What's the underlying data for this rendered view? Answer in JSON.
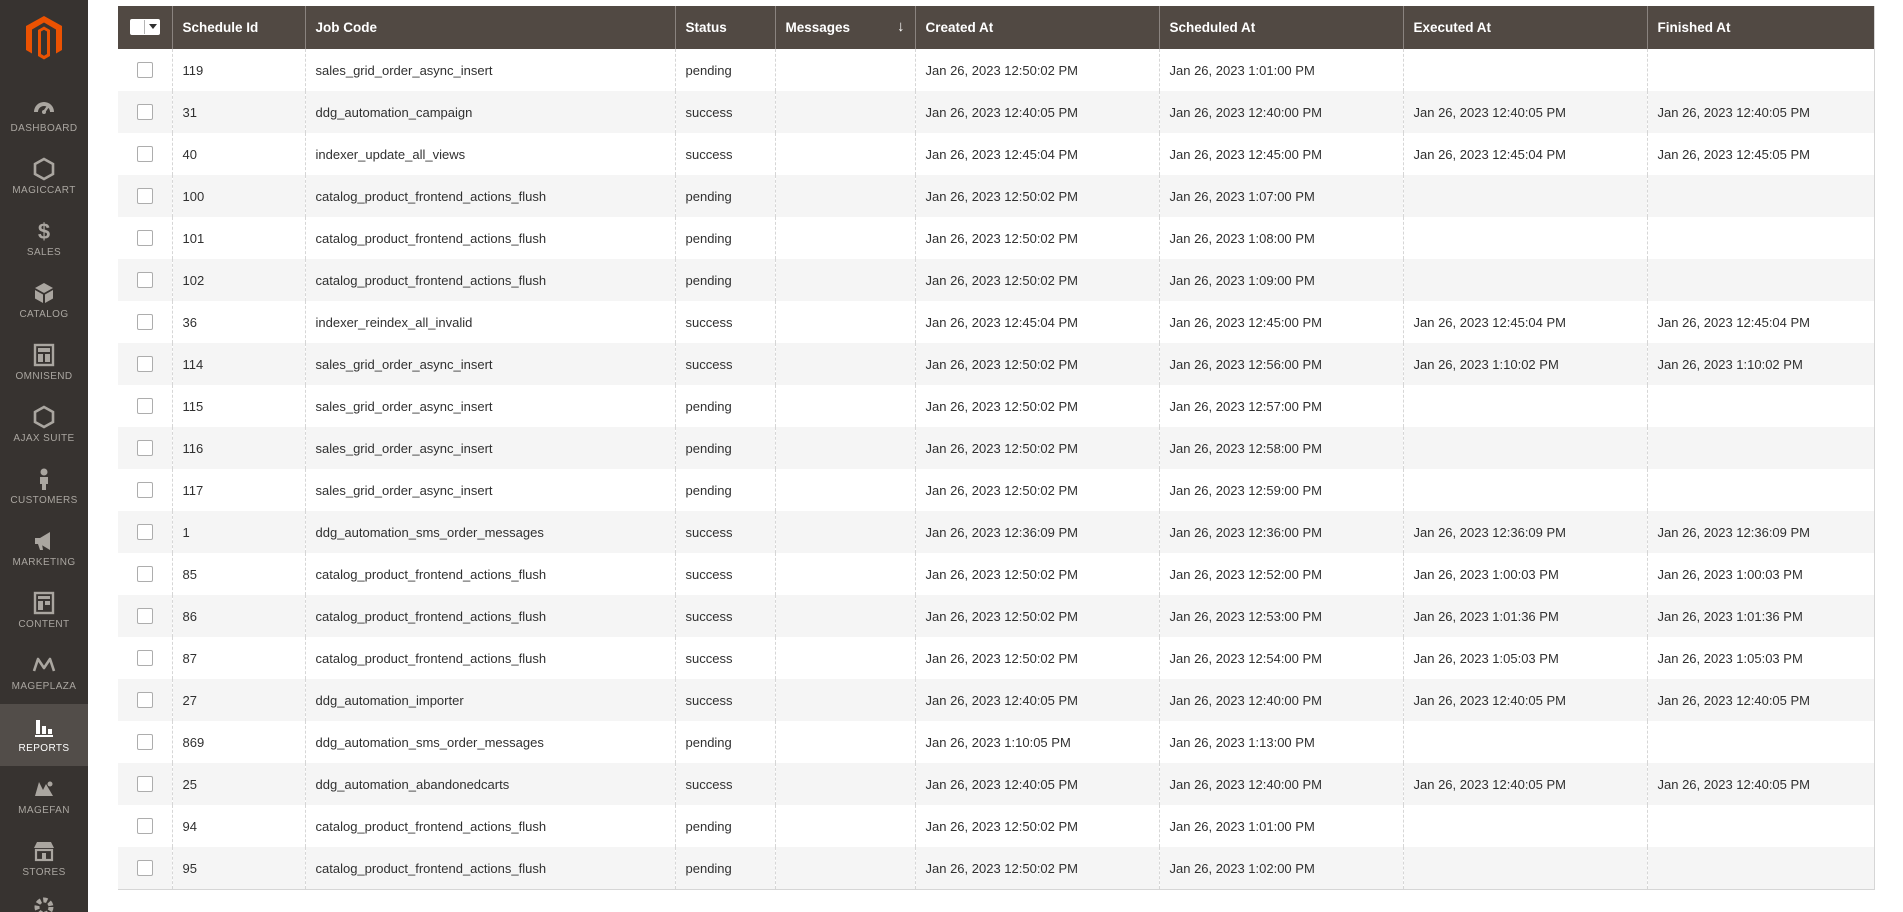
{
  "sidebar": {
    "items": [
      {
        "label": "DASHBOARD",
        "icon": "dashboard-icon"
      },
      {
        "label": "MAGICCART",
        "icon": "hexagon-icon"
      },
      {
        "label": "SALES",
        "icon": "dollar-icon"
      },
      {
        "label": "CATALOG",
        "icon": "box-icon"
      },
      {
        "label": "OMNISEND",
        "icon": "layout-icon"
      },
      {
        "label": "AJAX SUITE",
        "icon": "hexagon-icon"
      },
      {
        "label": "CUSTOMERS",
        "icon": "person-icon"
      },
      {
        "label": "MARKETING",
        "icon": "megaphone-icon"
      },
      {
        "label": "CONTENT",
        "icon": "content-icon"
      },
      {
        "label": "MAGEPLAZA",
        "icon": "mageplaza-icon"
      },
      {
        "label": "REPORTS",
        "icon": "bar-chart-icon"
      },
      {
        "label": "MAGEFAN",
        "icon": "magefan-icon"
      },
      {
        "label": "STORES",
        "icon": "store-icon"
      }
    ],
    "active": "REPORTS"
  },
  "grid": {
    "columns": [
      "Schedule Id",
      "Job Code",
      "Status",
      "Messages",
      "Created At",
      "Scheduled At",
      "Executed At",
      "Finished At"
    ],
    "sorted_column": "Messages",
    "sort_symbol": "↓",
    "rows": [
      [
        "119",
        "sales_grid_order_async_insert",
        "pending",
        "",
        "Jan 26, 2023 12:50:02 PM",
        "Jan 26, 2023 1:01:00 PM",
        "",
        ""
      ],
      [
        "31",
        "ddg_automation_campaign",
        "success",
        "",
        "Jan 26, 2023 12:40:05 PM",
        "Jan 26, 2023 12:40:00 PM",
        "Jan 26, 2023 12:40:05 PM",
        "Jan 26, 2023 12:40:05 PM"
      ],
      [
        "40",
        "indexer_update_all_views",
        "success",
        "",
        "Jan 26, 2023 12:45:04 PM",
        "Jan 26, 2023 12:45:00 PM",
        "Jan 26, 2023 12:45:04 PM",
        "Jan 26, 2023 12:45:05 PM"
      ],
      [
        "100",
        "catalog_product_frontend_actions_flush",
        "pending",
        "",
        "Jan 26, 2023 12:50:02 PM",
        "Jan 26, 2023 1:07:00 PM",
        "",
        ""
      ],
      [
        "101",
        "catalog_product_frontend_actions_flush",
        "pending",
        "",
        "Jan 26, 2023 12:50:02 PM",
        "Jan 26, 2023 1:08:00 PM",
        "",
        ""
      ],
      [
        "102",
        "catalog_product_frontend_actions_flush",
        "pending",
        "",
        "Jan 26, 2023 12:50:02 PM",
        "Jan 26, 2023 1:09:00 PM",
        "",
        ""
      ],
      [
        "36",
        "indexer_reindex_all_invalid",
        "success",
        "",
        "Jan 26, 2023 12:45:04 PM",
        "Jan 26, 2023 12:45:00 PM",
        "Jan 26, 2023 12:45:04 PM",
        "Jan 26, 2023 12:45:04 PM"
      ],
      [
        "114",
        "sales_grid_order_async_insert",
        "success",
        "",
        "Jan 26, 2023 12:50:02 PM",
        "Jan 26, 2023 12:56:00 PM",
        "Jan 26, 2023 1:10:02 PM",
        "Jan 26, 2023 1:10:02 PM"
      ],
      [
        "115",
        "sales_grid_order_async_insert",
        "pending",
        "",
        "Jan 26, 2023 12:50:02 PM",
        "Jan 26, 2023 12:57:00 PM",
        "",
        ""
      ],
      [
        "116",
        "sales_grid_order_async_insert",
        "pending",
        "",
        "Jan 26, 2023 12:50:02 PM",
        "Jan 26, 2023 12:58:00 PM",
        "",
        ""
      ],
      [
        "117",
        "sales_grid_order_async_insert",
        "pending",
        "",
        "Jan 26, 2023 12:50:02 PM",
        "Jan 26, 2023 12:59:00 PM",
        "",
        ""
      ],
      [
        "1",
        "ddg_automation_sms_order_messages",
        "success",
        "",
        "Jan 26, 2023 12:36:09 PM",
        "Jan 26, 2023 12:36:00 PM",
        "Jan 26, 2023 12:36:09 PM",
        "Jan 26, 2023 12:36:09 PM"
      ],
      [
        "85",
        "catalog_product_frontend_actions_flush",
        "success",
        "",
        "Jan 26, 2023 12:50:02 PM",
        "Jan 26, 2023 12:52:00 PM",
        "Jan 26, 2023 1:00:03 PM",
        "Jan 26, 2023 1:00:03 PM"
      ],
      [
        "86",
        "catalog_product_frontend_actions_flush",
        "success",
        "",
        "Jan 26, 2023 12:50:02 PM",
        "Jan 26, 2023 12:53:00 PM",
        "Jan 26, 2023 1:01:36 PM",
        "Jan 26, 2023 1:01:36 PM"
      ],
      [
        "87",
        "catalog_product_frontend_actions_flush",
        "success",
        "",
        "Jan 26, 2023 12:50:02 PM",
        "Jan 26, 2023 12:54:00 PM",
        "Jan 26, 2023 1:05:03 PM",
        "Jan 26, 2023 1:05:03 PM"
      ],
      [
        "27",
        "ddg_automation_importer",
        "success",
        "",
        "Jan 26, 2023 12:40:05 PM",
        "Jan 26, 2023 12:40:00 PM",
        "Jan 26, 2023 12:40:05 PM",
        "Jan 26, 2023 12:40:05 PM"
      ],
      [
        "869",
        "ddg_automation_sms_order_messages",
        "pending",
        "",
        "Jan 26, 2023 1:10:05 PM",
        "Jan 26, 2023 1:13:00 PM",
        "",
        ""
      ],
      [
        "25",
        "ddg_automation_abandonedcarts",
        "success",
        "",
        "Jan 26, 2023 12:40:05 PM",
        "Jan 26, 2023 12:40:00 PM",
        "Jan 26, 2023 12:40:05 PM",
        "Jan 26, 2023 12:40:05 PM"
      ],
      [
        "94",
        "catalog_product_frontend_actions_flush",
        "pending",
        "",
        "Jan 26, 2023 12:50:02 PM",
        "Jan 26, 2023 1:01:00 PM",
        "",
        ""
      ],
      [
        "95",
        "catalog_product_frontend_actions_flush",
        "pending",
        "",
        "Jan 26, 2023 12:50:02 PM",
        "Jan 26, 2023 1:02:00 PM",
        "",
        ""
      ]
    ]
  }
}
